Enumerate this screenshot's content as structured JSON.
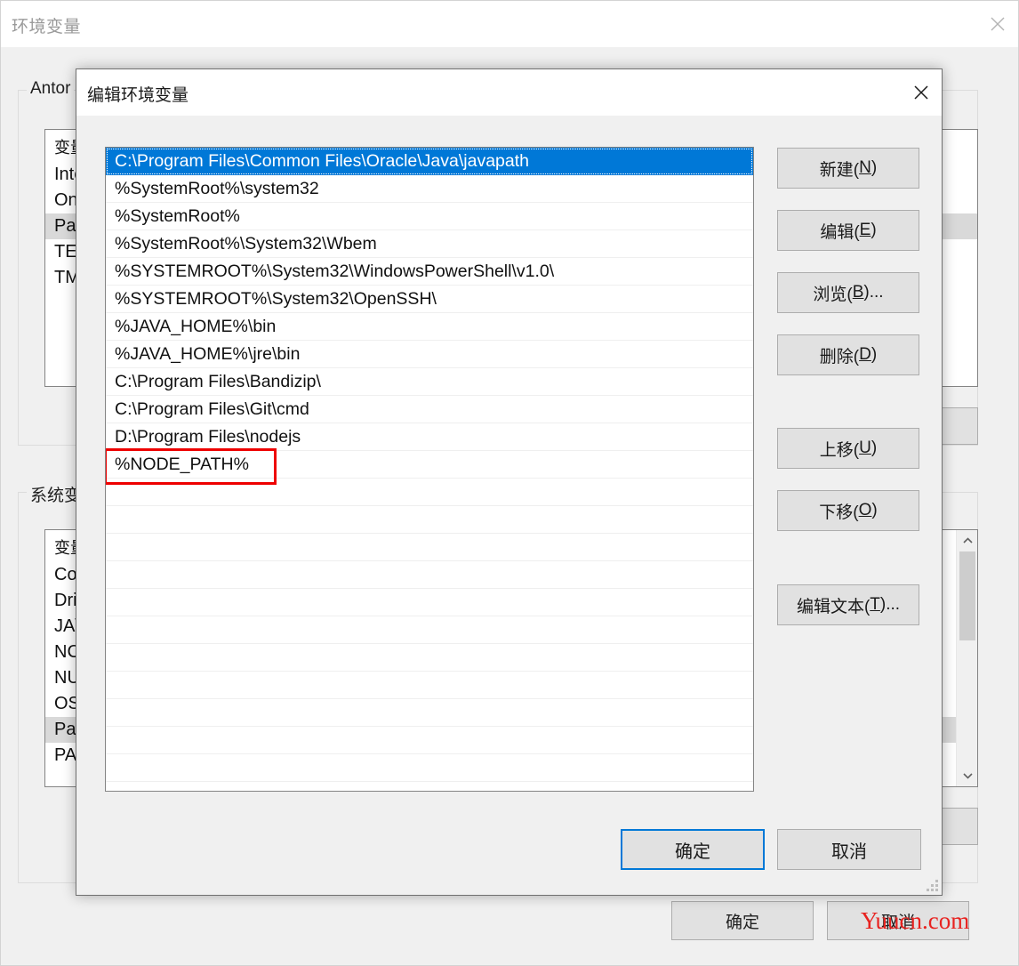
{
  "background_window": {
    "title": "环境变量",
    "close_icon": "close-icon",
    "user_vars_group_label": "Antor",
    "user_vars_header": "变量",
    "user_vars_rows": [
      "Inte",
      "On",
      "Pat",
      "TEI",
      "TM"
    ],
    "user_vars_selected_index": 2,
    "system_vars_group_label": "系统变",
    "system_vars_header": "变量",
    "system_vars_rows": [
      "Co",
      "Dri",
      "JA\\",
      "NC",
      "NU",
      "OS",
      "Pat",
      "PA"
    ],
    "system_vars_selected_index": 6,
    "ok_label": "确定",
    "cancel_label": "取消",
    "scrollbar": {
      "up_arrow_icon": "chevron-up-icon",
      "down_arrow_icon": "chevron-down-icon"
    }
  },
  "dialog": {
    "title": "编辑环境变量",
    "close_icon": "close-icon",
    "path_entries": [
      {
        "text": "C:\\Program Files\\Common Files\\Oracle\\Java\\javapath",
        "selected": true,
        "annotated": false
      },
      {
        "text": "%SystemRoot%\\system32",
        "selected": false,
        "annotated": false
      },
      {
        "text": "%SystemRoot%",
        "selected": false,
        "annotated": false
      },
      {
        "text": "%SystemRoot%\\System32\\Wbem",
        "selected": false,
        "annotated": false
      },
      {
        "text": "%SYSTEMROOT%\\System32\\WindowsPowerShell\\v1.0\\",
        "selected": false,
        "annotated": false
      },
      {
        "text": "%SYSTEMROOT%\\System32\\OpenSSH\\",
        "selected": false,
        "annotated": false
      },
      {
        "text": "%JAVA_HOME%\\bin",
        "selected": false,
        "annotated": false
      },
      {
        "text": "%JAVA_HOME%\\jre\\bin",
        "selected": false,
        "annotated": false
      },
      {
        "text": "C:\\Program Files\\Bandizip\\",
        "selected": false,
        "annotated": false
      },
      {
        "text": "C:\\Program Files\\Git\\cmd",
        "selected": false,
        "annotated": false
      },
      {
        "text": "D:\\Program Files\\nodejs",
        "selected": false,
        "annotated": false
      },
      {
        "text": "%NODE_PATH%",
        "selected": false,
        "annotated": true
      },
      {
        "text": "",
        "selected": false,
        "annotated": false
      },
      {
        "text": "",
        "selected": false,
        "annotated": false
      },
      {
        "text": "",
        "selected": false,
        "annotated": false
      },
      {
        "text": "",
        "selected": false,
        "annotated": false
      },
      {
        "text": "",
        "selected": false,
        "annotated": false
      },
      {
        "text": "",
        "selected": false,
        "annotated": false
      },
      {
        "text": "",
        "selected": false,
        "annotated": false
      },
      {
        "text": "",
        "selected": false,
        "annotated": false
      },
      {
        "text": "",
        "selected": false,
        "annotated": false
      },
      {
        "text": "",
        "selected": false,
        "annotated": false
      },
      {
        "text": "",
        "selected": false,
        "annotated": false
      }
    ],
    "buttons": {
      "new": {
        "label": "新建(N)",
        "pre": "新建(",
        "acc": "N",
        "post": ")"
      },
      "edit": {
        "label": "编辑(E)",
        "pre": "编辑(",
        "acc": "E",
        "post": ")"
      },
      "browse": {
        "label": "浏览(B)...",
        "pre": "浏览(",
        "acc": "B",
        "post": ")..."
      },
      "delete": {
        "label": "删除(D)",
        "pre": "删除(",
        "acc": "D",
        "post": ")"
      },
      "move_up": {
        "label": "上移(U)",
        "pre": "上移(",
        "acc": "U",
        "post": ")"
      },
      "move_down": {
        "label": "下移(O)",
        "pre": "下移(",
        "acc": "O",
        "post": ")"
      },
      "edit_text": {
        "label": "编辑文本(T)...",
        "pre": "编辑文本(",
        "acc": "T",
        "post": ")..."
      }
    },
    "ok_label": "确定",
    "cancel_label": "取消",
    "resize_grip": "resize-grip-icon"
  },
  "watermark": {
    "text": "Yuucn.com",
    "color": "#e8221f"
  },
  "colors": {
    "accent": "#0078d7",
    "annotation": "#ee0000",
    "window_bg": "#f0f0f0",
    "button_bg": "#e1e1e1"
  }
}
